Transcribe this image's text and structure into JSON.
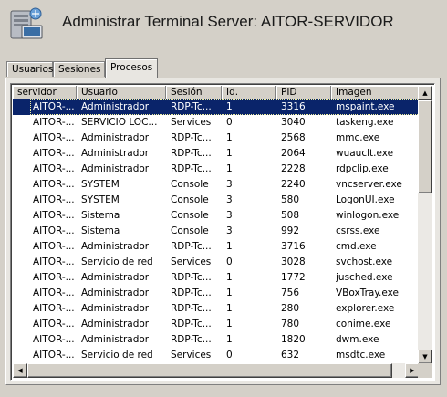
{
  "window": {
    "title": "Administrar Terminal Server: AITOR-SERVIDOR",
    "icon": "terminal-server-icon"
  },
  "tabs": [
    {
      "label": "Usuarios",
      "active": false
    },
    {
      "label": "Sesiones",
      "active": false
    },
    {
      "label": "Procesos",
      "active": true
    }
  ],
  "table": {
    "columns": [
      "servidor",
      "Usuario",
      "Sesión",
      "Id.",
      "PID",
      "Imagen"
    ],
    "selected_row": 0,
    "rows": [
      [
        "AITOR-...",
        "Administrador",
        "RDP-Tc...",
        "1",
        "3316",
        "mspaint.exe"
      ],
      [
        "AITOR-...",
        "SERVICIO LOC...",
        "Services",
        "0",
        "3040",
        "taskeng.exe"
      ],
      [
        "AITOR-...",
        "Administrador",
        "RDP-Tc...",
        "1",
        "2568",
        "mmc.exe"
      ],
      [
        "AITOR-...",
        "Administrador",
        "RDP-Tc...",
        "1",
        "2064",
        "wuauclt.exe"
      ],
      [
        "AITOR-...",
        "Administrador",
        "RDP-Tc...",
        "1",
        "2228",
        "rdpclip.exe"
      ],
      [
        "AITOR-...",
        "SYSTEM",
        "Console",
        "3",
        "2240",
        "vncserver.exe"
      ],
      [
        "AITOR-...",
        "SYSTEM",
        "Console",
        "3",
        "580",
        "LogonUI.exe"
      ],
      [
        "AITOR-...",
        "Sistema",
        "Console",
        "3",
        "508",
        "winlogon.exe"
      ],
      [
        "AITOR-...",
        "Sistema",
        "Console",
        "3",
        "992",
        "csrss.exe"
      ],
      [
        "AITOR-...",
        "Administrador",
        "RDP-Tc...",
        "1",
        "3716",
        "cmd.exe"
      ],
      [
        "AITOR-...",
        "Servicio de red",
        "Services",
        "0",
        "3028",
        "svchost.exe"
      ],
      [
        "AITOR-...",
        "Administrador",
        "RDP-Tc...",
        "1",
        "1772",
        "jusched.exe"
      ],
      [
        "AITOR-...",
        "Administrador",
        "RDP-Tc...",
        "1",
        "756",
        "VBoxTray.exe"
      ],
      [
        "AITOR-...",
        "Administrador",
        "RDP-Tc...",
        "1",
        "280",
        "explorer.exe"
      ],
      [
        "AITOR-...",
        "Administrador",
        "RDP-Tc...",
        "1",
        "780",
        "conime.exe"
      ],
      [
        "AITOR-...",
        "Administrador",
        "RDP-Tc...",
        "1",
        "1820",
        "dwm.exe"
      ],
      [
        "AITOR-...",
        "Servicio de red",
        "Services",
        "0",
        "632",
        "msdtc.exe"
      ]
    ]
  },
  "scrollbars": {
    "up_icon": "scroll-up-arrow-icon",
    "down_icon": "scroll-down-arrow-icon",
    "left_icon": "scroll-left-arrow-icon",
    "right_icon": "scroll-right-arrow-icon"
  },
  "colors": {
    "selection": "#0a246a",
    "window_bg": "#d4d0c8"
  }
}
